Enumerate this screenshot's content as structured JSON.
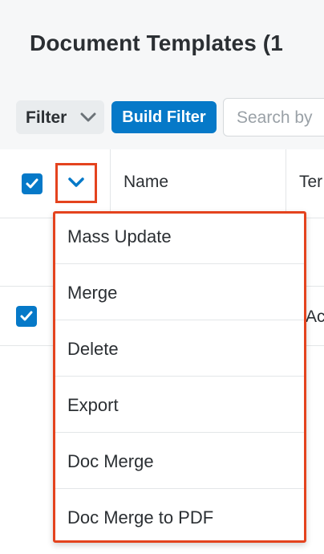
{
  "header": {
    "title": "Document Templates (1"
  },
  "toolbar": {
    "filter_label": "Filter",
    "build_filter_label": "Build Filter",
    "search_placeholder": "Search by"
  },
  "table": {
    "columns": [
      "Name",
      "Ter"
    ],
    "rows": [
      {
        "selected": true,
        "partial_text": "Ac"
      }
    ]
  },
  "mass_actions": {
    "items": [
      "Mass Update",
      "Merge",
      "Delete",
      "Export",
      "Doc Merge",
      "Doc Merge to PDF"
    ]
  },
  "colors": {
    "accent": "#0679c8",
    "highlight": "#e4431e",
    "header_bg": "#f6f7f8"
  }
}
